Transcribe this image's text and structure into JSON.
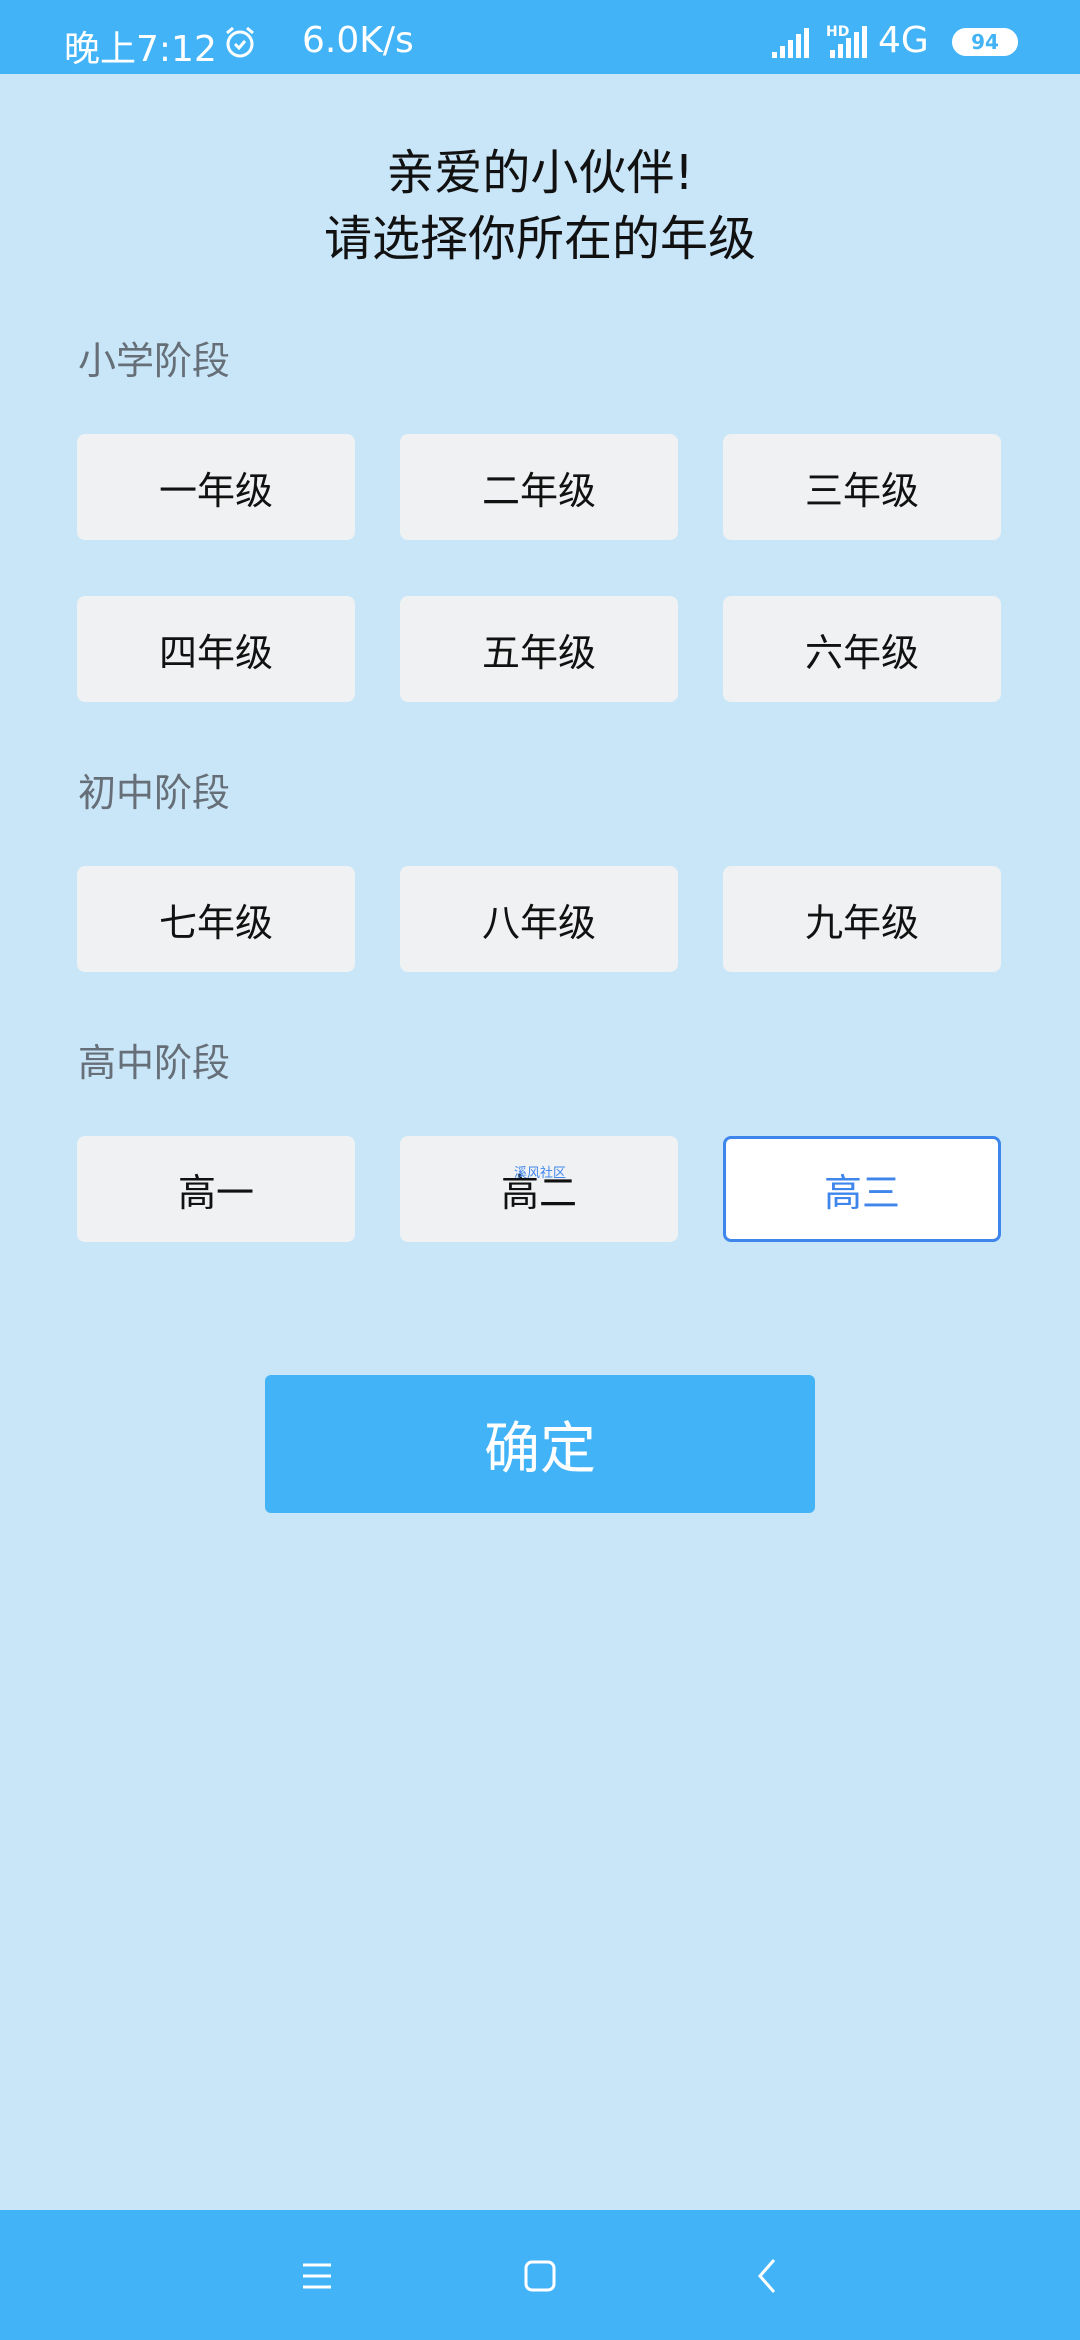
{
  "status_bar": {
    "time": "晚上7:12",
    "alarm_icon": "alarm-clock-icon",
    "speed": "6.0K/s",
    "hd_label": "HD",
    "network": "4G",
    "battery": "94"
  },
  "heading": {
    "line1": "亲爱的小伙伴!",
    "line2": "请选择你所在的年级"
  },
  "sections": {
    "primary": {
      "label": "小学阶段",
      "grades": [
        "一年级",
        "二年级",
        "三年级",
        "四年级",
        "五年级",
        "六年级"
      ]
    },
    "middle": {
      "label": "初中阶段",
      "grades": [
        "七年级",
        "八年级",
        "九年级"
      ]
    },
    "high": {
      "label": "高中阶段",
      "grades": [
        "高一",
        "高二",
        "高三"
      ],
      "selected": "高三"
    }
  },
  "watermark": "溪风社区",
  "confirm_label": "确定",
  "nav_bar": {
    "icons": [
      "menu-icon",
      "home-icon",
      "back-icon"
    ]
  },
  "colors": {
    "status_bar_bg": "#43b3f7",
    "page_bg": "#c9e6f9",
    "button_bg": "#eff1f2",
    "selected_border": "#3f86ec",
    "confirm_bg": "#43b3f7"
  }
}
